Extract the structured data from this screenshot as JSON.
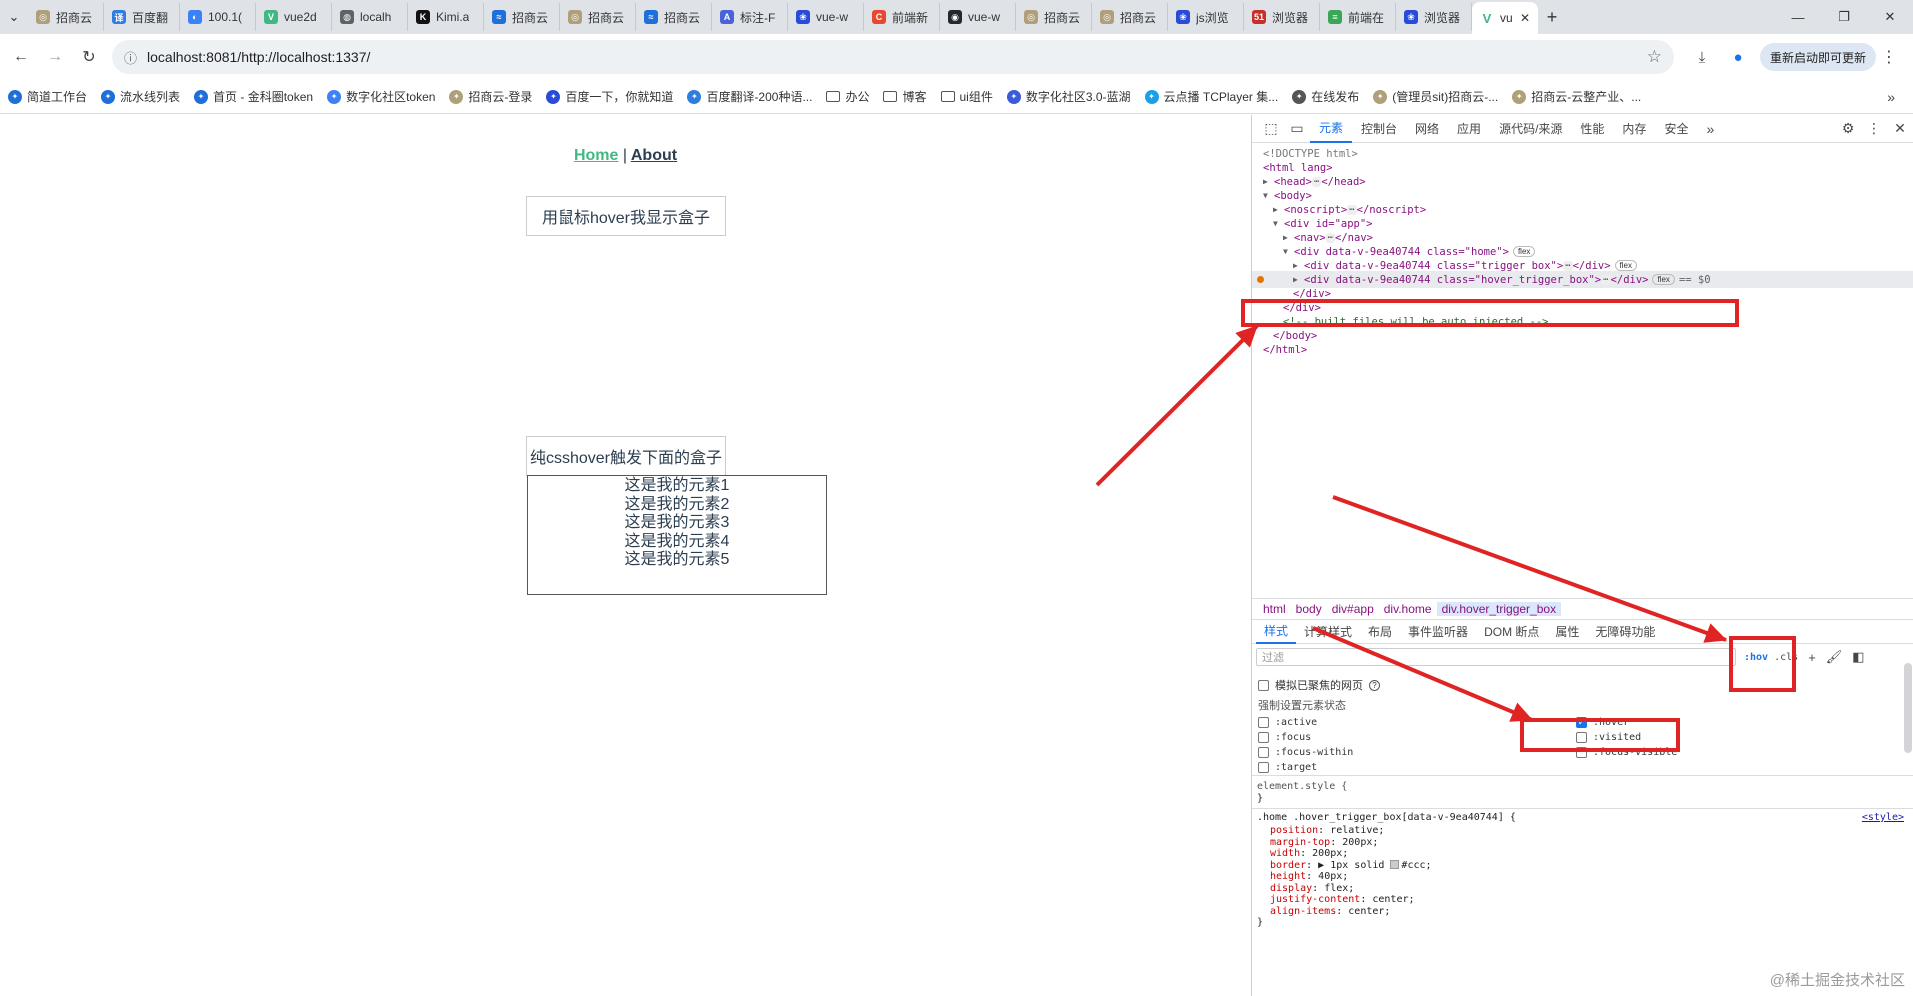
{
  "browser": {
    "tabs": [
      {
        "label": "招商云",
        "color": "#b0a07a",
        "glyph": "◎"
      },
      {
        "label": "百度翻",
        "color": "#2f7de1",
        "glyph": "译"
      },
      {
        "label": "100.1(",
        "color": "#3b82f6",
        "glyph": "◐"
      },
      {
        "label": "vue2d",
        "color": "#41b883",
        "glyph": "V"
      },
      {
        "label": "localh",
        "color": "#5f6368",
        "glyph": "◍"
      },
      {
        "label": "Kimi.a",
        "color": "#111111",
        "glyph": "K"
      },
      {
        "label": "招商云",
        "color": "#1e6fd9",
        "glyph": "≈"
      },
      {
        "label": "招商云",
        "color": "#b0a07a",
        "glyph": "◎"
      },
      {
        "label": "招商云",
        "color": "#1e6fd9",
        "glyph": "≈"
      },
      {
        "label": "标注-F",
        "color": "#4a63d8",
        "glyph": "A"
      },
      {
        "label": "vue-w",
        "color": "#2a4bd8",
        "glyph": "❀"
      },
      {
        "label": "前端新",
        "color": "#e8492e",
        "glyph": "C"
      },
      {
        "label": "vue-w",
        "color": "#24292f",
        "glyph": "◉"
      },
      {
        "label": "招商云",
        "color": "#b0a07a",
        "glyph": "◎"
      },
      {
        "label": "招商云",
        "color": "#b0a07a",
        "glyph": "◎"
      },
      {
        "label": "js浏览",
        "color": "#2a4bd8",
        "glyph": "❀"
      },
      {
        "label": "浏览器",
        "color": "#c7302a",
        "glyph": "51"
      },
      {
        "label": "前端在",
        "color": "#3aa757",
        "glyph": "≡"
      },
      {
        "label": "浏览器",
        "color": "#2a4bd8",
        "glyph": "❀"
      }
    ],
    "active_tab": {
      "label": "vu",
      "color": "#41b883",
      "glyph": "V"
    },
    "url": "localhost:8081/http://localhost:1337/",
    "relaunch_label": "重新启动即可更新",
    "bookmarks": [
      {
        "label": "简道工作台",
        "kind": "site",
        "color": "#1e6fd9"
      },
      {
        "label": "流水线列表",
        "kind": "site",
        "color": "#1e6fd9"
      },
      {
        "label": "首页 - 金科圈token",
        "kind": "site",
        "color": "#1e6fd9"
      },
      {
        "label": "数字化社区token",
        "kind": "site",
        "color": "#3b82f6"
      },
      {
        "label": "招商云-登录",
        "kind": "site",
        "color": "#b0a07a"
      },
      {
        "label": "百度一下，你就知道",
        "kind": "site",
        "color": "#2a4bd8"
      },
      {
        "label": "百度翻译-200种语...",
        "kind": "site",
        "color": "#2f7de1"
      },
      {
        "label": "办公",
        "kind": "folder",
        "color": "#555555"
      },
      {
        "label": "博客",
        "kind": "folder",
        "color": "#555555"
      },
      {
        "label": "ui组件",
        "kind": "folder",
        "color": "#555555"
      },
      {
        "label": "数字化社区3.0-蓝湖",
        "kind": "site",
        "color": "#3b5bdb"
      },
      {
        "label": "云点播 TCPlayer 集...",
        "kind": "site",
        "color": "#1aa0e8"
      },
      {
        "label": "在线发布",
        "kind": "site",
        "color": "#555555"
      },
      {
        "label": "(管理员sit)招商云-...",
        "kind": "site",
        "color": "#b0a07a"
      },
      {
        "label": "招商云-云整产业、...",
        "kind": "site",
        "color": "#b0a07a"
      }
    ]
  },
  "page": {
    "nav_home": "Home",
    "nav_sep": "|",
    "nav_about": "About",
    "trigger_box_text": "用鼠标hover我显示盒子",
    "hover_trigger_text": "纯csshover触发下面的盒子",
    "revealed_items": [
      "这是我的元素1",
      "这是我的元素2",
      "这是我的元素3",
      "这是我的元素4",
      "这是我的元素5"
    ]
  },
  "devtools": {
    "tabs": [
      "元素",
      "控制台",
      "网络",
      "应用",
      "源代码/来源",
      "性能",
      "内存",
      "安全"
    ],
    "active_tab": "元素",
    "dom": {
      "doctype": "<!DOCTYPE html>",
      "html_open": "<html lang>",
      "head": "<head>",
      "head_close": "</head>",
      "body_open": "<body>",
      "noscript": "<noscript>",
      "noscript_close": "</noscript>",
      "div_app": "<div id=\"app\">",
      "nav": "<nav>",
      "nav_close": "</nav>",
      "div_home": "<div data-v-9ea40744 class=\"home\">",
      "trigger_div": "<div data-v-9ea40744 class=\"trigger_box\">",
      "hover_div": "<div data-v-9ea40744 class=\"hover_trigger_box\">",
      "div_close": "</div>",
      "ellipsis": "⋯",
      "flex_badge": "flex",
      "dollar": "== $0",
      "comment": "<!-- built files will be auto injected -->",
      "body_close": "</body>",
      "html_close": "</html>"
    },
    "breadcrumbs": [
      "html",
      "body",
      "div#app",
      "div.home",
      "div.hover_trigger_box"
    ],
    "subtabs": [
      "样式",
      "计算样式",
      "布局",
      "事件监听器",
      "DOM 断点",
      "属性",
      "无障碍功能"
    ],
    "active_subtab": "样式",
    "filter_placeholder": "过滤",
    "hov_label": ":hov",
    "cls_label": ".cls",
    "emulate_focus_label": "模拟已聚焦的网页",
    "force_state_label": "强制设置元素状态",
    "states_left": [
      {
        "name": ":active",
        "checked": false
      },
      {
        "name": ":focus",
        "checked": false
      },
      {
        "name": ":focus-within",
        "checked": false
      },
      {
        "name": ":target",
        "checked": false
      }
    ],
    "states_right": [
      {
        "name": ":hover",
        "checked": true
      },
      {
        "name": ":visited",
        "checked": false
      },
      {
        "name": ":focus-visible",
        "checked": false
      }
    ],
    "element_style": "element.style {",
    "close_brace": "}",
    "rule_selector": ".home .hover_trigger_box[data-v-9ea40744] {",
    "rule_source": "<style>",
    "rule_props": [
      {
        "prop": "position",
        "value": "relative;"
      },
      {
        "prop": "margin-top",
        "value": "200px;"
      },
      {
        "prop": "width",
        "value": "200px;"
      },
      {
        "prop": "border",
        "value": "▶ 1px solid #ccc;"
      },
      {
        "prop": "height",
        "value": "40px;"
      },
      {
        "prop": "display",
        "value": "flex;"
      },
      {
        "prop": "justify-content",
        "value": "center;"
      },
      {
        "prop": "align-items",
        "value": "center;"
      }
    ]
  },
  "annotation": {
    "color": "#e02424",
    "watermark": "@稀土掘金技术社区"
  }
}
